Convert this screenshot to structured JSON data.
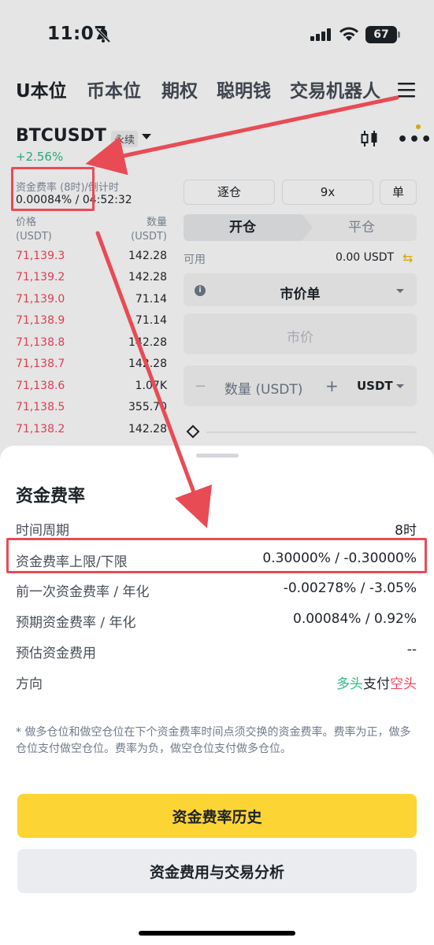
{
  "status_bar": {
    "time": "11:07",
    "battery": "67"
  },
  "top_nav": {
    "tabs": [
      "U本位",
      "币本位",
      "期权",
      "聪明钱",
      "交易机器人"
    ]
  },
  "symbol": {
    "name": "BTCUSDT",
    "contract_type": "永续",
    "change": "+2.56%"
  },
  "funding_mini": {
    "label": "资金费率 (8时)/倒计时",
    "value": "0.00084% / 04:52:32"
  },
  "order_book": {
    "price_header": [
      "价格",
      "(USDT)"
    ],
    "qty_header": [
      "数量",
      "(USDT)"
    ],
    "rows": [
      {
        "price": "71,139.3",
        "qty": "142.28"
      },
      {
        "price": "71,139.2",
        "qty": "142.28"
      },
      {
        "price": "71,139.0",
        "qty": "71.14"
      },
      {
        "price": "71,138.9",
        "qty": "71.14"
      },
      {
        "price": "71,138.8",
        "qty": "142.28"
      },
      {
        "price": "71,138.7",
        "qty": "142.28"
      },
      {
        "price": "71,138.6",
        "qty": "1.07K"
      },
      {
        "price": "71,138.5",
        "qty": "355.70"
      },
      {
        "price": "71,138.2",
        "qty": "142.28"
      }
    ]
  },
  "trade_form": {
    "margin_mode": "逐仓",
    "leverage": "9x",
    "position_mode": "单",
    "tab_open": "开仓",
    "tab_close": "平仓",
    "available_label": "可用",
    "available_value": "0.00 USDT",
    "order_type": "市价单",
    "price_placeholder": "市价",
    "qty_minus": "−",
    "qty_placeholder": "数量 (USDT)",
    "qty_plus": "+",
    "qty_unit": "USDT"
  },
  "sheet": {
    "title": "资金费率",
    "rows": [
      {
        "label": "时间周期",
        "value": "8时"
      },
      {
        "label": "资金费率上限/下限",
        "value": "0.30000% / -0.30000%"
      },
      {
        "label": "前一次资金费率 / 年化",
        "value": "-0.00278% / -3.05%"
      },
      {
        "label": "预期资金费率 / 年化",
        "value": "0.00084% / 0.92%"
      },
      {
        "label": "预估资金费用",
        "value": "--"
      }
    ],
    "direction": {
      "label": "方向",
      "long": "多头",
      "pays": "支付",
      "short": "空头"
    },
    "note": "* 做多仓位和做空仓位在下个资金费率时间点须交换的资金费率。费率为正，做多仓位支付做空仓位。费率为负，做空仓位支付做多仓位。",
    "btn_history": "资金费率历史",
    "btn_analysis": "资金费用与交易分析"
  },
  "colors": {
    "accent": "#fcd535",
    "up": "#2ebd85",
    "down": "#f6465d",
    "annotation": "#e94b55"
  }
}
